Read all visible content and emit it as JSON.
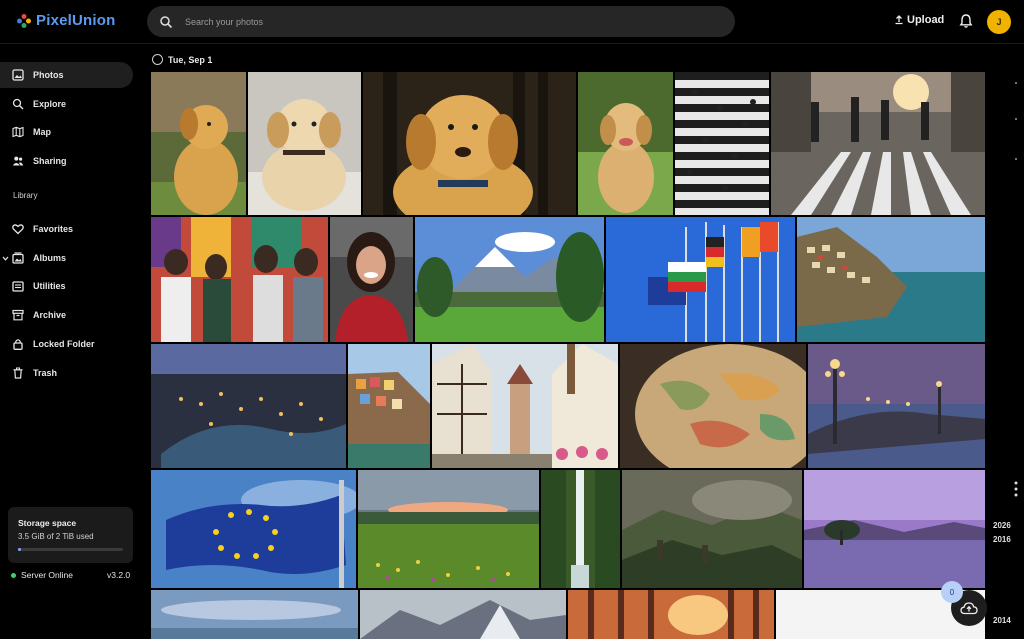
{
  "app": {
    "name": "PixelUnion"
  },
  "search": {
    "placeholder": "Search your photos"
  },
  "header": {
    "upload_label": "Upload",
    "avatar_initial": "J"
  },
  "sidebar": {
    "items": [
      {
        "label": "Photos",
        "icon": "photos-icon",
        "active": true
      },
      {
        "label": "Explore",
        "icon": "search-icon"
      },
      {
        "label": "Map",
        "icon": "map-icon"
      },
      {
        "label": "Sharing",
        "icon": "people-icon"
      }
    ],
    "library_heading": "Library",
    "library_items": [
      {
        "label": "Favorites",
        "icon": "heart-icon"
      },
      {
        "label": "Albums",
        "icon": "album-icon",
        "expandable": true
      },
      {
        "label": "Utilities",
        "icon": "utilities-icon"
      },
      {
        "label": "Archive",
        "icon": "archive-icon"
      },
      {
        "label": "Locked Folder",
        "icon": "lock-icon"
      },
      {
        "label": "Trash",
        "icon": "trash-icon"
      }
    ],
    "storage": {
      "title": "Storage space",
      "used": "3.5 GiB of 2 TiB used",
      "fraction_used": 0.0017
    },
    "server_status": "Server Online",
    "version": "v3.2.0"
  },
  "main": {
    "date_group": "Tue, Sep 1",
    "photos": [
      {
        "subject": "golden retriever puppy profile"
      },
      {
        "subject": "golden retriever puppy lying"
      },
      {
        "subject": "golden retriever puppy close-up"
      },
      {
        "subject": "golden retriever puppy on grass"
      },
      {
        "subject": "crosswalk from above"
      },
      {
        "subject": "city crosswalk with pedestrians"
      },
      {
        "subject": "friends by mural"
      },
      {
        "subject": "smiling woman in red"
      },
      {
        "subject": "mountain lake park"
      },
      {
        "subject": "flags of nations"
      },
      {
        "subject": "coastal cliff village"
      },
      {
        "subject": "town at dusk"
      },
      {
        "subject": "colorful cliff houses"
      },
      {
        "subject": "old town street"
      },
      {
        "subject": "vintage globe"
      },
      {
        "subject": "bridge at twilight"
      },
      {
        "subject": "EU flag"
      },
      {
        "subject": "wildflower meadow"
      },
      {
        "subject": "waterfall"
      },
      {
        "subject": "misty mountains"
      },
      {
        "subject": "tree in purple lake"
      },
      {
        "subject": "sky"
      },
      {
        "subject": "snowy mountains"
      },
      {
        "subject": "forest at sunset"
      },
      {
        "subject": "white"
      }
    ]
  },
  "timeline": {
    "years": [
      "2026",
      "2016",
      "2014"
    ]
  },
  "fab": {
    "count": "0"
  },
  "colors": {
    "accent": "#5b9cf0",
    "avatar": "#f0b400",
    "online": "#3ecf6e"
  }
}
